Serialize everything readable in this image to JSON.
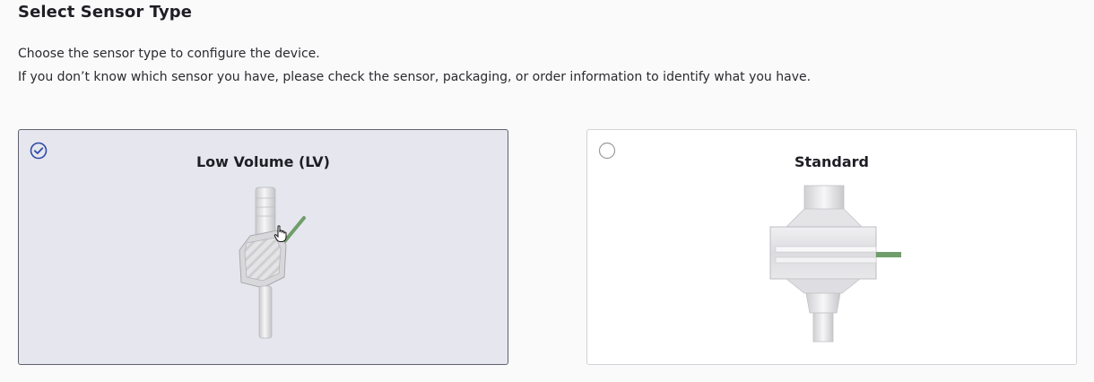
{
  "page": {
    "title": "Select Sensor Type",
    "description_line1": "Choose the sensor type to configure the device.",
    "description_line2": "If you don’t know which sensor you have, please check the sensor, packaging, or order information to identify what you have."
  },
  "options": [
    {
      "label": "Low Volume (LV)",
      "selected": true,
      "icon": "low-volume-sensor-image"
    },
    {
      "label": "Standard",
      "selected": false,
      "icon": "standard-sensor-image"
    }
  ],
  "colors": {
    "accent": "#2f4aa8",
    "selected_card_bg": "#e6e6ee",
    "selected_card_border": "#5f6170",
    "card_border": "#d2d2d8",
    "sensor_green": "#6f9e6a"
  }
}
